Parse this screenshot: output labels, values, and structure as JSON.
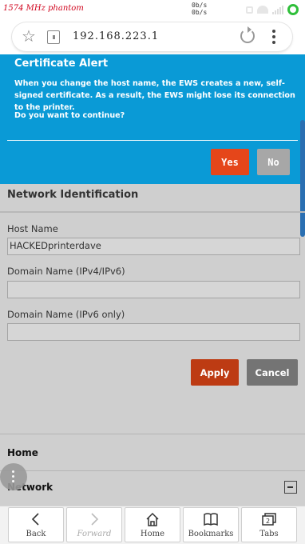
{
  "status_bar": {
    "network_label": "1574 MHz phantom",
    "upload_speed": "0b/s",
    "download_speed": "0b/s"
  },
  "browser": {
    "url": "192.168.223.1"
  },
  "alert": {
    "title": "Certificate Alert",
    "message": "When you change the host name, the EWS creates a new, self-signed certificate. As a result, the EWS might lose its connection to the printer.",
    "question": "Do you want to continue?",
    "yes_label": "Yes",
    "no_label": "No",
    "background_color": "#0a9ad6",
    "yes_color": "#e5461a"
  },
  "form": {
    "section_title": "Network Identification",
    "host_name_label": "Host Name",
    "host_name_value": "HACKEDprinterdave",
    "domain_v4v6_label": "Domain Name (IPv4/IPv6)",
    "domain_v4v6_value": "",
    "domain_v6_label": "Domain Name (IPv6 only)",
    "domain_v6_value": "",
    "apply_label": "Apply",
    "cancel_label": "Cancel"
  },
  "nav": {
    "home_label": "Home",
    "network_label": "Network"
  },
  "bottom_nav": {
    "back_label": "Back",
    "forward_label": "Forward",
    "home_label": "Home",
    "bookmarks_label": "Bookmarks",
    "tabs_label": "Tabs"
  }
}
